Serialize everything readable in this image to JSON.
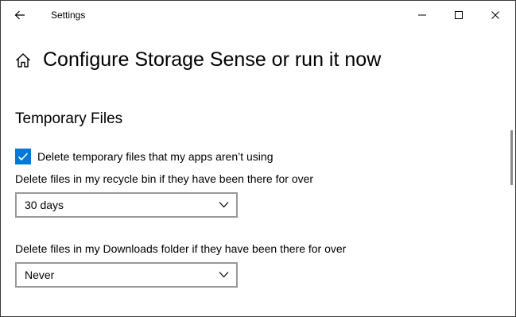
{
  "window": {
    "title": "Settings"
  },
  "titlebar": {
    "back_icon": "back-arrow-icon",
    "minimize_icon": "minimize-icon",
    "maximize_icon": "maximize-icon",
    "close_icon": "close-icon"
  },
  "header": {
    "home_icon": "home-icon",
    "title": "Configure Storage Sense or run it now"
  },
  "temporary_files": {
    "heading": "Temporary Files",
    "delete_temp_checkbox": {
      "label": "Delete temporary files that my apps aren’t using",
      "checked": true
    },
    "recycle_bin": {
      "label": "Delete files in my recycle bin if they have been there for over",
      "selected": "30 days"
    },
    "downloads": {
      "label": "Delete files in my Downloads folder if they have been there for over",
      "selected": "Never"
    }
  },
  "colors": {
    "accent": "#0078d7",
    "dropdown_border": "#999999",
    "scrollbar": "#8a8a8a"
  }
}
